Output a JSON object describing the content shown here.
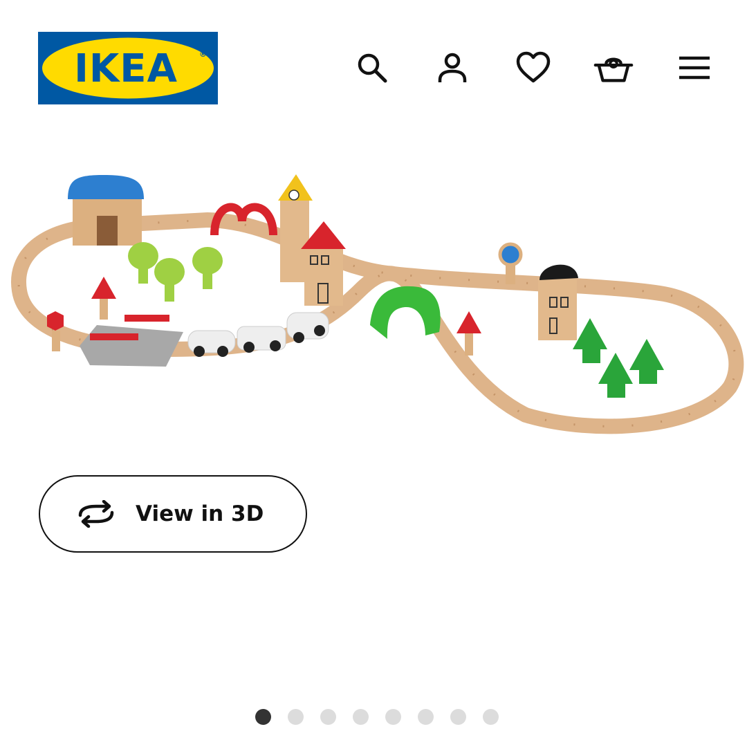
{
  "header": {
    "logo_text": "IKEA",
    "logo_mark": "®",
    "icons": [
      "search-icon",
      "account-icon",
      "heart-icon",
      "basket-icon",
      "menu-icon"
    ]
  },
  "product": {
    "image_description_icon": "product-image"
  },
  "view_3d": {
    "label": "View in 3D",
    "icon": "rotate-3d-icon"
  },
  "carousel": {
    "total": 8,
    "active_index": 0
  },
  "colors": {
    "ikea_blue": "#0058a3",
    "ikea_yellow": "#ffdb00",
    "text": "#111111",
    "dot_inactive": "#dcdcdc",
    "dot_active": "#333333"
  }
}
